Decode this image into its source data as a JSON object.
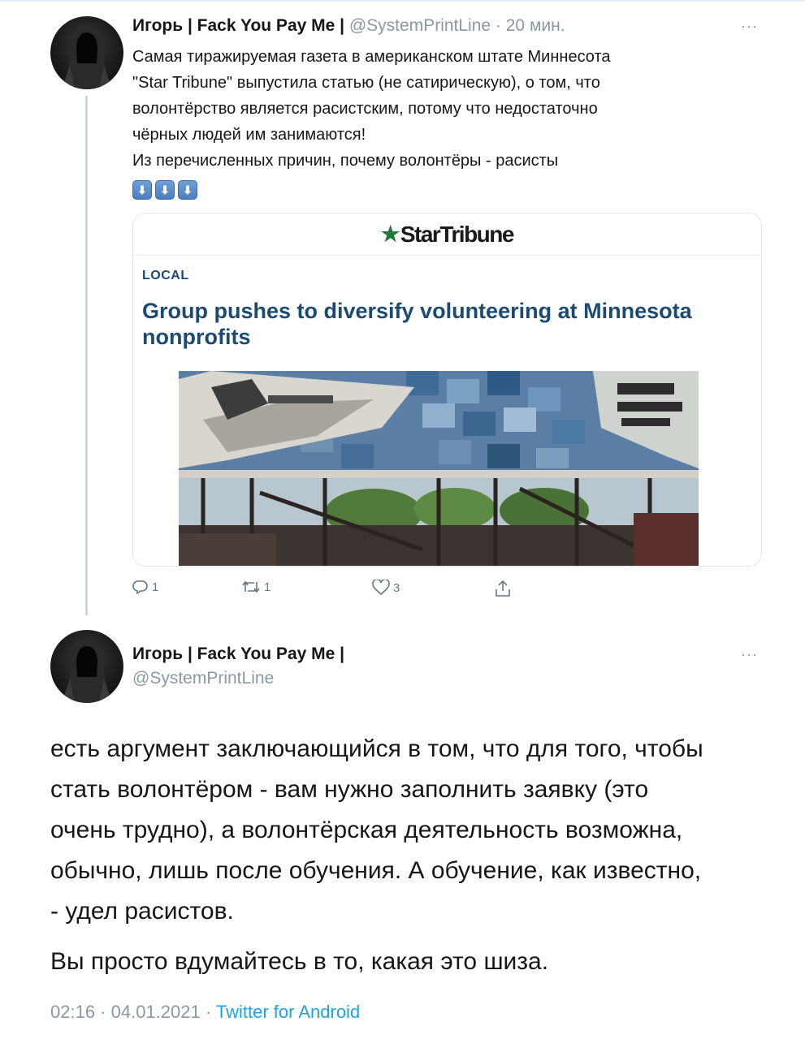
{
  "tweet1": {
    "display_name": "Игорь | Fack You Pay Me |",
    "handle": "@SystemPrintLine",
    "time": "· 20 мин.",
    "more": "···",
    "text_lines": [
      "Самая тиражируемая газета в американском штате Миннесота",
      "\"Star Tribune\" выпустила статью (не сатирическую), о том, что",
      "волонтёрство является расистским, потому что недостаточно",
      "чёрных людей им занимаются!",
      "Из перечисленных причин, почему волонтёры - расисты"
    ],
    "emoji": [
      "⬇",
      "⬇",
      "⬇"
    ],
    "card": {
      "brand": "StarTribune",
      "brand_star": "★",
      "section": "LOCAL",
      "headline": "Group pushes to diversify volunteering at Minnesota nonprofits"
    },
    "actions": {
      "replies": "1",
      "retweets": "1",
      "likes": "3"
    }
  },
  "tweet2": {
    "display_name": "Игорь | Fack You Pay Me |",
    "handle": "@SystemPrintLine",
    "more": "···",
    "paragraph1_lines": [
      "есть аргумент заключающийся в том, что для того, чтобы",
      "стать волонтёром - вам нужно заполнить заявку (это",
      "очень трудно), а волонтёрская деятельность возможна,",
      "обычно, лишь после обучения. А обучение, как известно,",
      "- удел расистов."
    ],
    "paragraph2": "Вы просто вдумайтесь в то, какая это шиза.",
    "timestamp": "02:16 · 04.01.2021 · ",
    "source": "Twitter for Android"
  },
  "colors": {
    "text": "#14171a",
    "secondary": "#8899a6",
    "link": "#1da1f2",
    "headline": "#1b4a72",
    "brand_star": "#1f7a3a"
  }
}
